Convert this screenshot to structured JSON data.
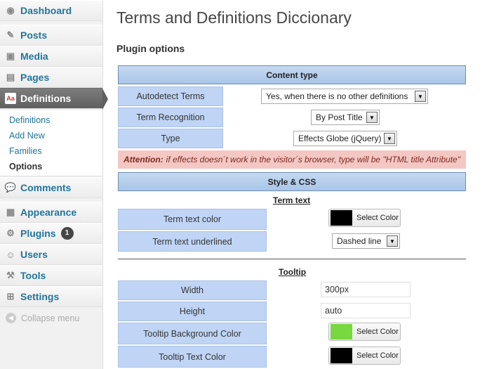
{
  "sidebar": {
    "items": [
      {
        "label": "Dashboard",
        "icon": "dashboard-icon"
      },
      {
        "label": "Posts",
        "icon": "pin-icon"
      },
      {
        "label": "Media",
        "icon": "media-icon"
      },
      {
        "label": "Pages",
        "icon": "pages-icon"
      },
      {
        "label": "Definitions",
        "icon": "definitions-icon"
      },
      {
        "label": "Comments",
        "icon": "comment-icon"
      },
      {
        "label": "Appearance",
        "icon": "appearance-icon"
      },
      {
        "label": "Plugins",
        "icon": "plugins-icon",
        "badge": "1"
      },
      {
        "label": "Users",
        "icon": "users-icon"
      },
      {
        "label": "Tools",
        "icon": "tools-icon"
      },
      {
        "label": "Settings",
        "icon": "settings-icon"
      }
    ],
    "submenu": [
      "Definitions",
      "Add New",
      "Families",
      "Options"
    ],
    "collapse_label": "Collapse menu"
  },
  "page": {
    "title": "Terms and Definitions Diccionary",
    "subtitle": "Plugin options"
  },
  "content_type": {
    "header": "Content type",
    "autodetect_label": "Autodetect Terms",
    "autodetect_value": "Yes, when there is no other definitions",
    "recognition_label": "Term Recognition",
    "recognition_value": "By Post Title",
    "type_label": "Type",
    "type_value": "Effects Globe (jQuery)",
    "attention_strong": "Attention:",
    "attention_text": "if effects doesn´t work in the visitor´s browser, type will be \"HTML title Attribute\""
  },
  "style_css": {
    "header": "Style & CSS",
    "term_text_heading": "Term text",
    "term_color_label": "Term text color",
    "term_color_button": "Select Color",
    "term_color_value": "#000000",
    "underline_label": "Term text underlined",
    "underline_value": "Dashed line",
    "tooltip_heading": "Tooltip",
    "width_label": "Width",
    "width_value": "300px",
    "height_label": "Height",
    "height_value": "auto",
    "bg_color_label": "Tooltip Background Color",
    "bg_color_button": "Select Color",
    "bg_color_value": "#77d840",
    "text_color_label": "Tooltip Text Color",
    "text_color_button": "Select Color",
    "text_color_value": "#000000"
  }
}
